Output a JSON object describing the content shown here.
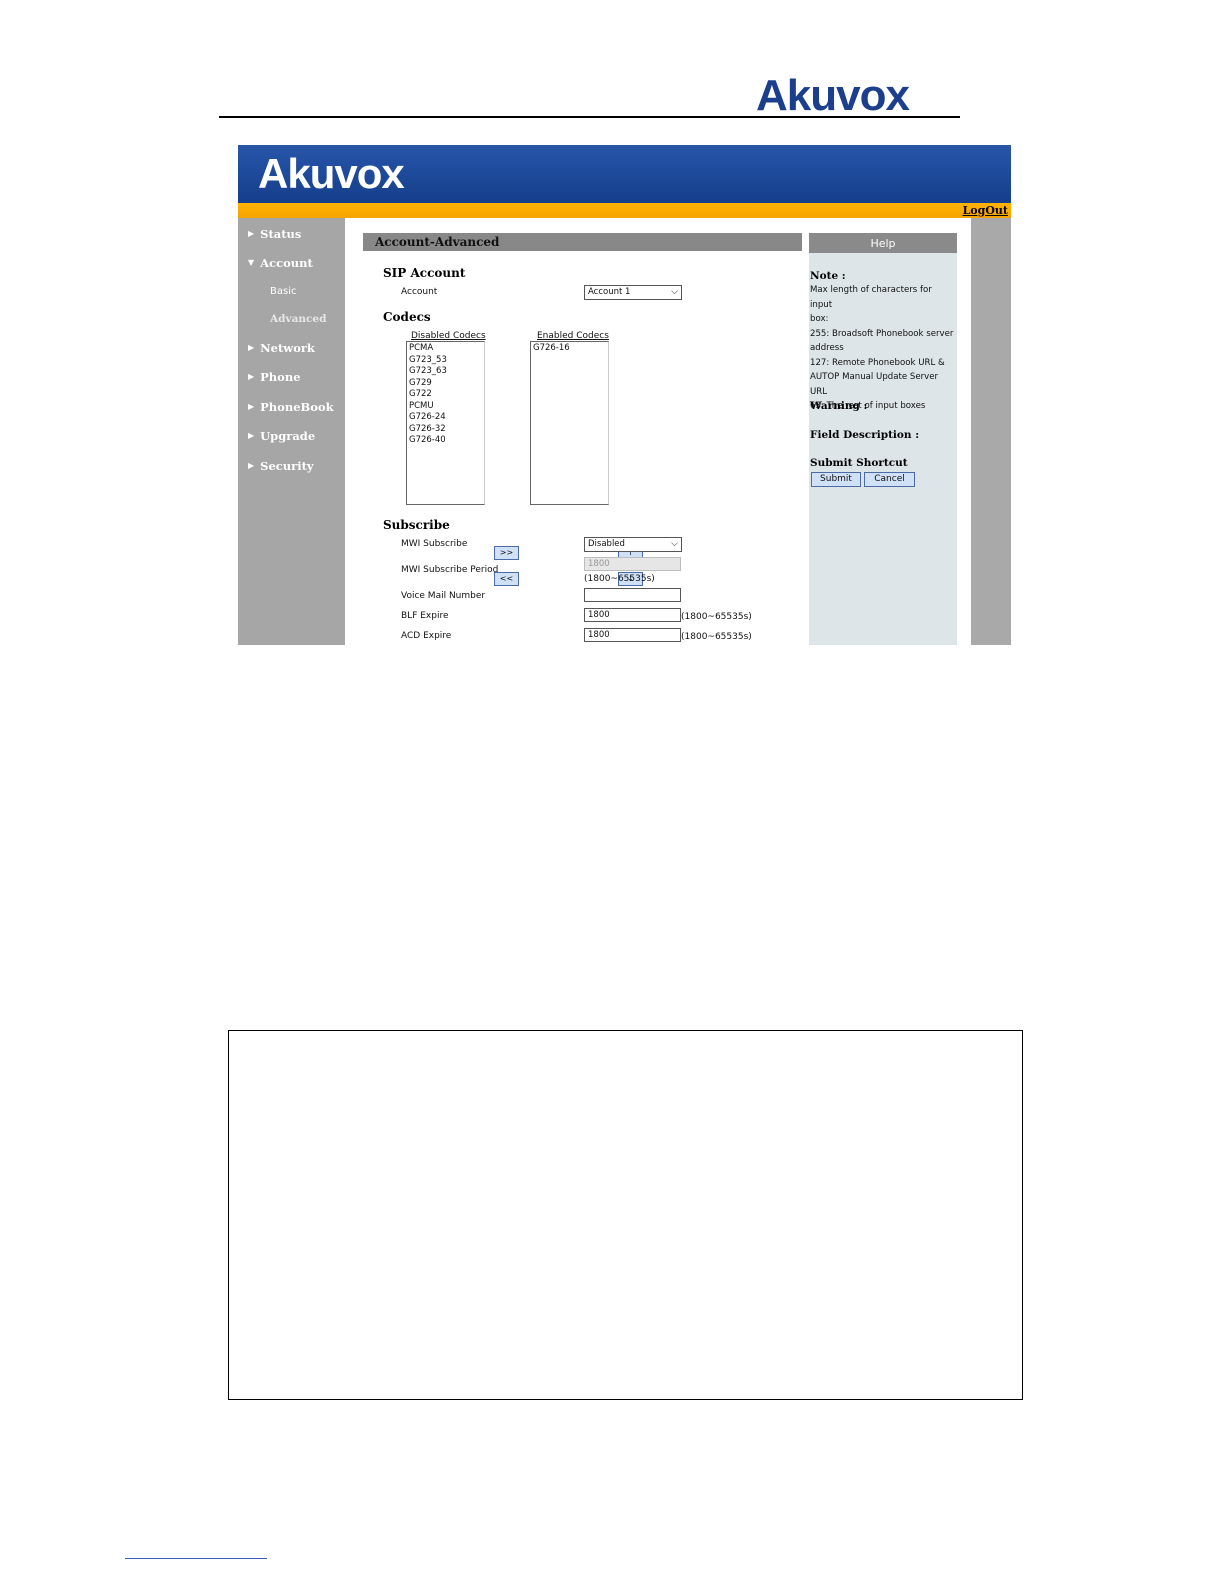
{
  "document": {
    "brand": "Akuvox"
  },
  "app": {
    "brand": "Akuvox",
    "logout": "LogOut"
  },
  "nav": {
    "items": [
      {
        "label": "Status"
      },
      {
        "label": "Account"
      },
      {
        "label": "Network"
      },
      {
        "label": "Phone"
      },
      {
        "label": "PhoneBook"
      },
      {
        "label": "Upgrade"
      },
      {
        "label": "Security"
      }
    ],
    "account_sub": [
      {
        "label": "Basic"
      },
      {
        "label": "Advanced",
        "active": true
      }
    ]
  },
  "page": {
    "title": "Account-Advanced",
    "sip_account": {
      "heading": "SIP Account",
      "account_label": "Account",
      "account_value": "Account 1"
    },
    "codecs": {
      "heading": "Codecs",
      "disabled_title": "Disabled Codecs",
      "enabled_title": "Enabled Codecs",
      "disabled": [
        "PCMA",
        "G723_53",
        "G723_63",
        "G729",
        "G722",
        "PCMU",
        "G726-24",
        "G726-32",
        "G726-40"
      ],
      "enabled": [
        "G726-16"
      ],
      "add_button": ">>",
      "remove_button": "<<",
      "up_button": "↑",
      "down_button": "↓"
    },
    "subscribe": {
      "heading": "Subscribe",
      "mwi_subscribe_label": "MWI Subscribe",
      "mwi_subscribe_value": "Disabled",
      "mwi_period_label": "MWI Subscribe Period",
      "mwi_period_value": "1800",
      "mwi_period_hint": "(1800~65535s)",
      "voicemail_label": "Voice Mail Number",
      "voicemail_value": "",
      "blf_label": "BLF Expire",
      "blf_value": "1800",
      "blf_hint": "(1800~65535s)",
      "acd_label": "ACD Expire",
      "acd_value": "1800",
      "acd_hint": "(1800~65535s)"
    }
  },
  "help": {
    "header": "Help",
    "note_title": "Note :",
    "note_lines": [
      "Max length of characters for input",
      "box:",
      "255: Broadsoft Phonebook server",
      "address",
      "127: Remote Phonebook URL &",
      "AUTOP Manual Update Server URL",
      "63: The rest of input boxes"
    ],
    "warning_title": "Warning :",
    "field_desc_title": "Field Description :",
    "shortcut_title": "Submit Shortcut",
    "submit": "Submit",
    "cancel": "Cancel"
  },
  "colors": {
    "brand_blue": "#1b3f8c",
    "banner_blue": "#1f4c9e",
    "orange_bar": "#f6a400",
    "nav_gray": "#a6a6a6",
    "button_blue": "#cfe0f7"
  }
}
